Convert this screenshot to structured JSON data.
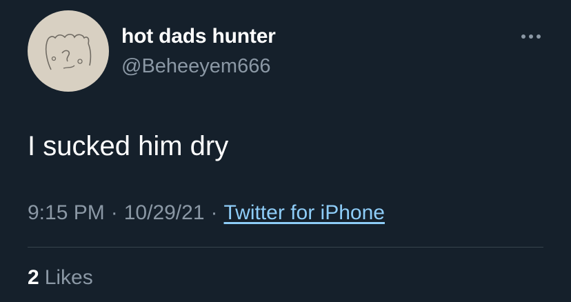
{
  "tweet": {
    "author": {
      "display_name": "hot dads hunter",
      "handle": "@Beheeyem666",
      "avatar_icon": "hand-drawn-face-avatar"
    },
    "more_icon": "more-options-icon",
    "text": "I sucked him dry",
    "meta": {
      "time": "9:15 PM",
      "separator": "·",
      "date": "10/29/21",
      "source": "Twitter for iPhone"
    },
    "stats": {
      "likes_count": "2",
      "likes_label": "Likes"
    }
  },
  "colors": {
    "background": "#15202b",
    "primary_text": "#ffffff",
    "secondary_text": "#8b98a5",
    "link": "#8ecdf8",
    "divider": "#38444d"
  }
}
